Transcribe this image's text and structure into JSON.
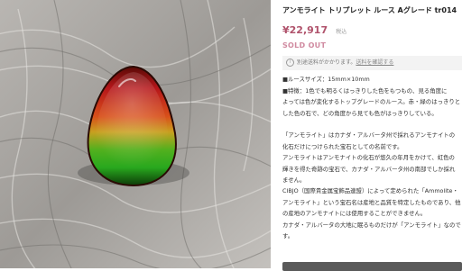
{
  "product": {
    "title": "アンモライト トリプレット ルース Aグレード tr014",
    "price": "¥22,917",
    "tax_label": "税込",
    "status": "SOLD OUT",
    "shipping_prefix": "別途送料がかかります。",
    "shipping_link": "送料を確認する"
  },
  "description": {
    "spec": [
      "■ルースサイズ：15mm×10mm",
      "■特徴：1色でも明るくはっきりした色をもつもの、見る角度に",
      "よっては色が変化するトップグレードのルース。赤・緑のはっきりと",
      "した色の石で、どの角度から見ても色がはっきりしている。"
    ],
    "about": [
      "「アンモライト」はカナダ・アルバータ州で採れるアンモナイトの",
      "化石だけにつけられた宝石としての名前です。",
      "アンモライトはアンモナイトの化石が悠久の年月をかけて、虹色の",
      "輝きを得た奇跡の宝石で、カナダ・アルバータ州の南部でしか採れ",
      "ません。"
    ],
    "cibjo": [
      "CIBJO（国際貴金属宝飾品連盟）によって定められた「Ammolite・",
      "アンモライト」という宝石名は産地と品質を特定したものであり、他",
      "の産地のアンモナイトには使用することができません。",
      "カナダ・アルバータの大地に眠るものだけが「アンモライト」なので",
      "す。"
    ]
  },
  "colors": {
    "price": "#b0536c",
    "sold_out": "#d08aa0",
    "stone_red": "#b5161a",
    "stone_green": "#28a81e"
  }
}
